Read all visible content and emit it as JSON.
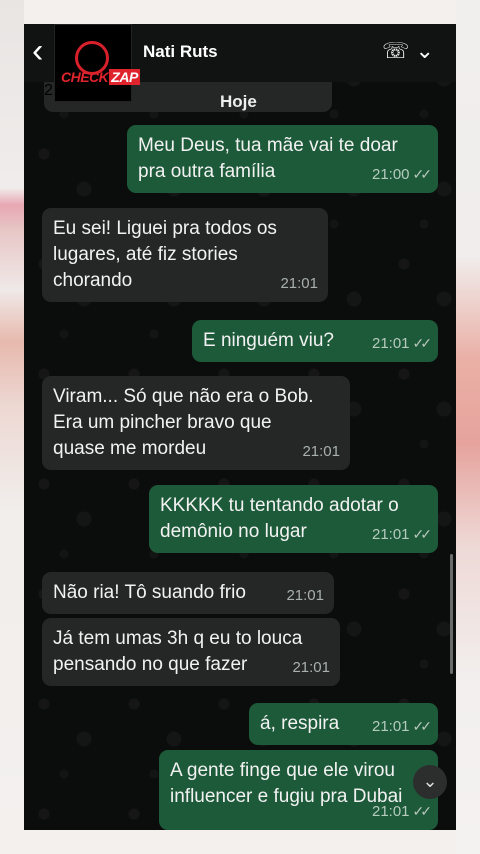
{
  "header": {
    "contact_name": "Nati Ruts",
    "logo_text_1": "CHECK",
    "logo_text_2": "ZAP",
    "back_icon": "chevron-left-icon",
    "call_icon": "phone-icon"
  },
  "date_label": "Hoje",
  "top_message_time": "21:00",
  "messages": [
    {
      "dir": "out",
      "text": "Meu Deus, tua mãe vai te doar\npra outra família",
      "time": "21:00",
      "ticks": "✓✓"
    },
    {
      "dir": "in",
      "text": "Eu sei! Liguei pra todos os\nlugares, até fiz stories\nchorando",
      "time": "21:01"
    },
    {
      "dir": "out",
      "text": "E ninguém viu?",
      "time": "21:01",
      "ticks": "✓✓"
    },
    {
      "dir": "in",
      "text": "Viram... Só que não era o Bob.\nEra um pincher bravo que\nquase me mordeu",
      "time": "21:01"
    },
    {
      "dir": "out",
      "text": "KKKKK tu tentando adotar o\ndemônio no lugar",
      "time": "21:01",
      "ticks": "✓✓"
    },
    {
      "dir": "in",
      "text": "Não ria! Tô suando frio",
      "time": "21:01"
    },
    {
      "dir": "in",
      "text": "Já tem umas 3h q eu to louca\npensando no que fazer",
      "time": "21:01"
    },
    {
      "dir": "out",
      "text": "á, respira",
      "time": "21:01",
      "ticks": "✓✓"
    },
    {
      "dir": "out",
      "text": "A gente finge que ele virou\ninfluencer e fugiu pra Dubai",
      "time": "21:01",
      "ticks": "✓✓"
    }
  ],
  "colors": {
    "incoming_bubble": "#252727",
    "outgoing_bubble": "#1d5a39",
    "logo_red": "#e0242e"
  }
}
